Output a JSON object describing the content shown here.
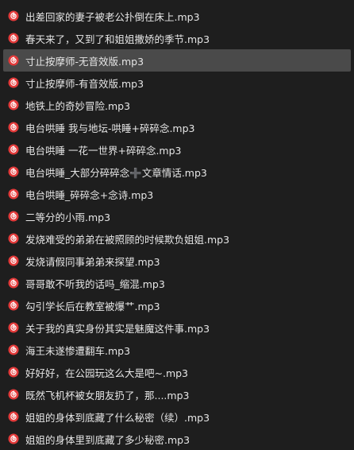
{
  "file_icon": "netease-music-file-icon",
  "accent_color": "#e33a3a",
  "selected_index": 2,
  "files": [
    {
      "name": "出差回家的妻子被老公扑倒在床上.mp3"
    },
    {
      "name": "春天来了，又到了和姐姐撒娇的季节.mp3"
    },
    {
      "name": "寸止按摩师-无音效版.mp3"
    },
    {
      "name": "寸止按摩师-有音效版.mp3"
    },
    {
      "name": "地铁上的奇妙冒险.mp3"
    },
    {
      "name": "电台哄睡 我与地坛-哄睡+碎碎念.mp3"
    },
    {
      "name": "电台哄睡 一花一世界+碎碎念.mp3"
    },
    {
      "name": "电台哄睡_大部分碎碎念➕文章情话.mp3"
    },
    {
      "name": "电台哄睡_碎碎念+念诗.mp3"
    },
    {
      "name": "二等分的小雨.mp3"
    },
    {
      "name": "发烧难受的弟弟在被照顾的时候欺负姐姐.mp3"
    },
    {
      "name": "发烧请假同事弟弟来探望.mp3"
    },
    {
      "name": "哥哥敢不听我的话吗_缩混.mp3"
    },
    {
      "name": "勾引学长后在教室被爆艹.mp3"
    },
    {
      "name": "关于我的真实身份其实是魅魔这件事.mp3"
    },
    {
      "name": "海王未遂惨遭翻车.mp3"
    },
    {
      "name": "好好好，在公园玩这么大是吧~.mp3"
    },
    {
      "name": "既然飞机杯被女朋友扔了，那....mp3"
    },
    {
      "name": "姐姐的身体到底藏了什么秘密（续）.mp3"
    },
    {
      "name": "姐姐的身体里到底藏了多少秘密.mp3"
    }
  ]
}
